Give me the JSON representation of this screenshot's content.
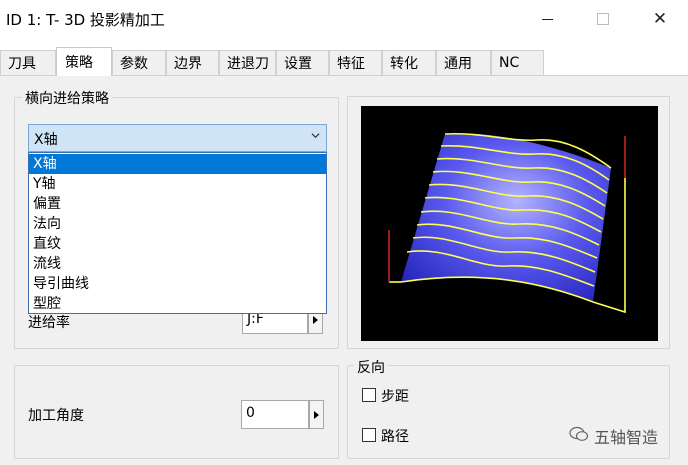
{
  "window": {
    "title": "ID 1: T- 3D 投影精加工",
    "controls": {
      "minimize": "minimize",
      "maximize": "maximize",
      "close": "close"
    }
  },
  "tabs": [
    {
      "label": "刀具",
      "active": false
    },
    {
      "label": "策略",
      "active": true
    },
    {
      "label": "参数",
      "active": false
    },
    {
      "label": "边界",
      "active": false
    },
    {
      "label": "进退刀",
      "active": false
    },
    {
      "label": "设置",
      "active": false
    },
    {
      "label": "特征",
      "active": false
    },
    {
      "label": "转化",
      "active": false
    },
    {
      "label": "通用",
      "active": false
    },
    {
      "label": "NC",
      "active": false
    }
  ],
  "strategy_group": {
    "legend": "横向进给策略",
    "selected": "X轴",
    "options": [
      "X轴",
      "Y轴",
      "偏置",
      "法向",
      "直纹",
      "流线",
      "导引曲线",
      "型腔"
    ],
    "highlighted_index": 0
  },
  "feed_row": {
    "label": "进给率",
    "value": "J:F"
  },
  "angle_group": {
    "label": "加工角度",
    "value": "0"
  },
  "reverse_group": {
    "legend": "反向",
    "options": [
      {
        "label": "步距",
        "checked": false
      },
      {
        "label": "路径",
        "checked": false
      }
    ]
  },
  "preview": {
    "description_icon": "toolpath-preview",
    "surface_color": "#3c3ce6",
    "path_color": "#ffff50",
    "axis_color": "#cc2222"
  },
  "watermark": {
    "text": "五轴智造"
  }
}
